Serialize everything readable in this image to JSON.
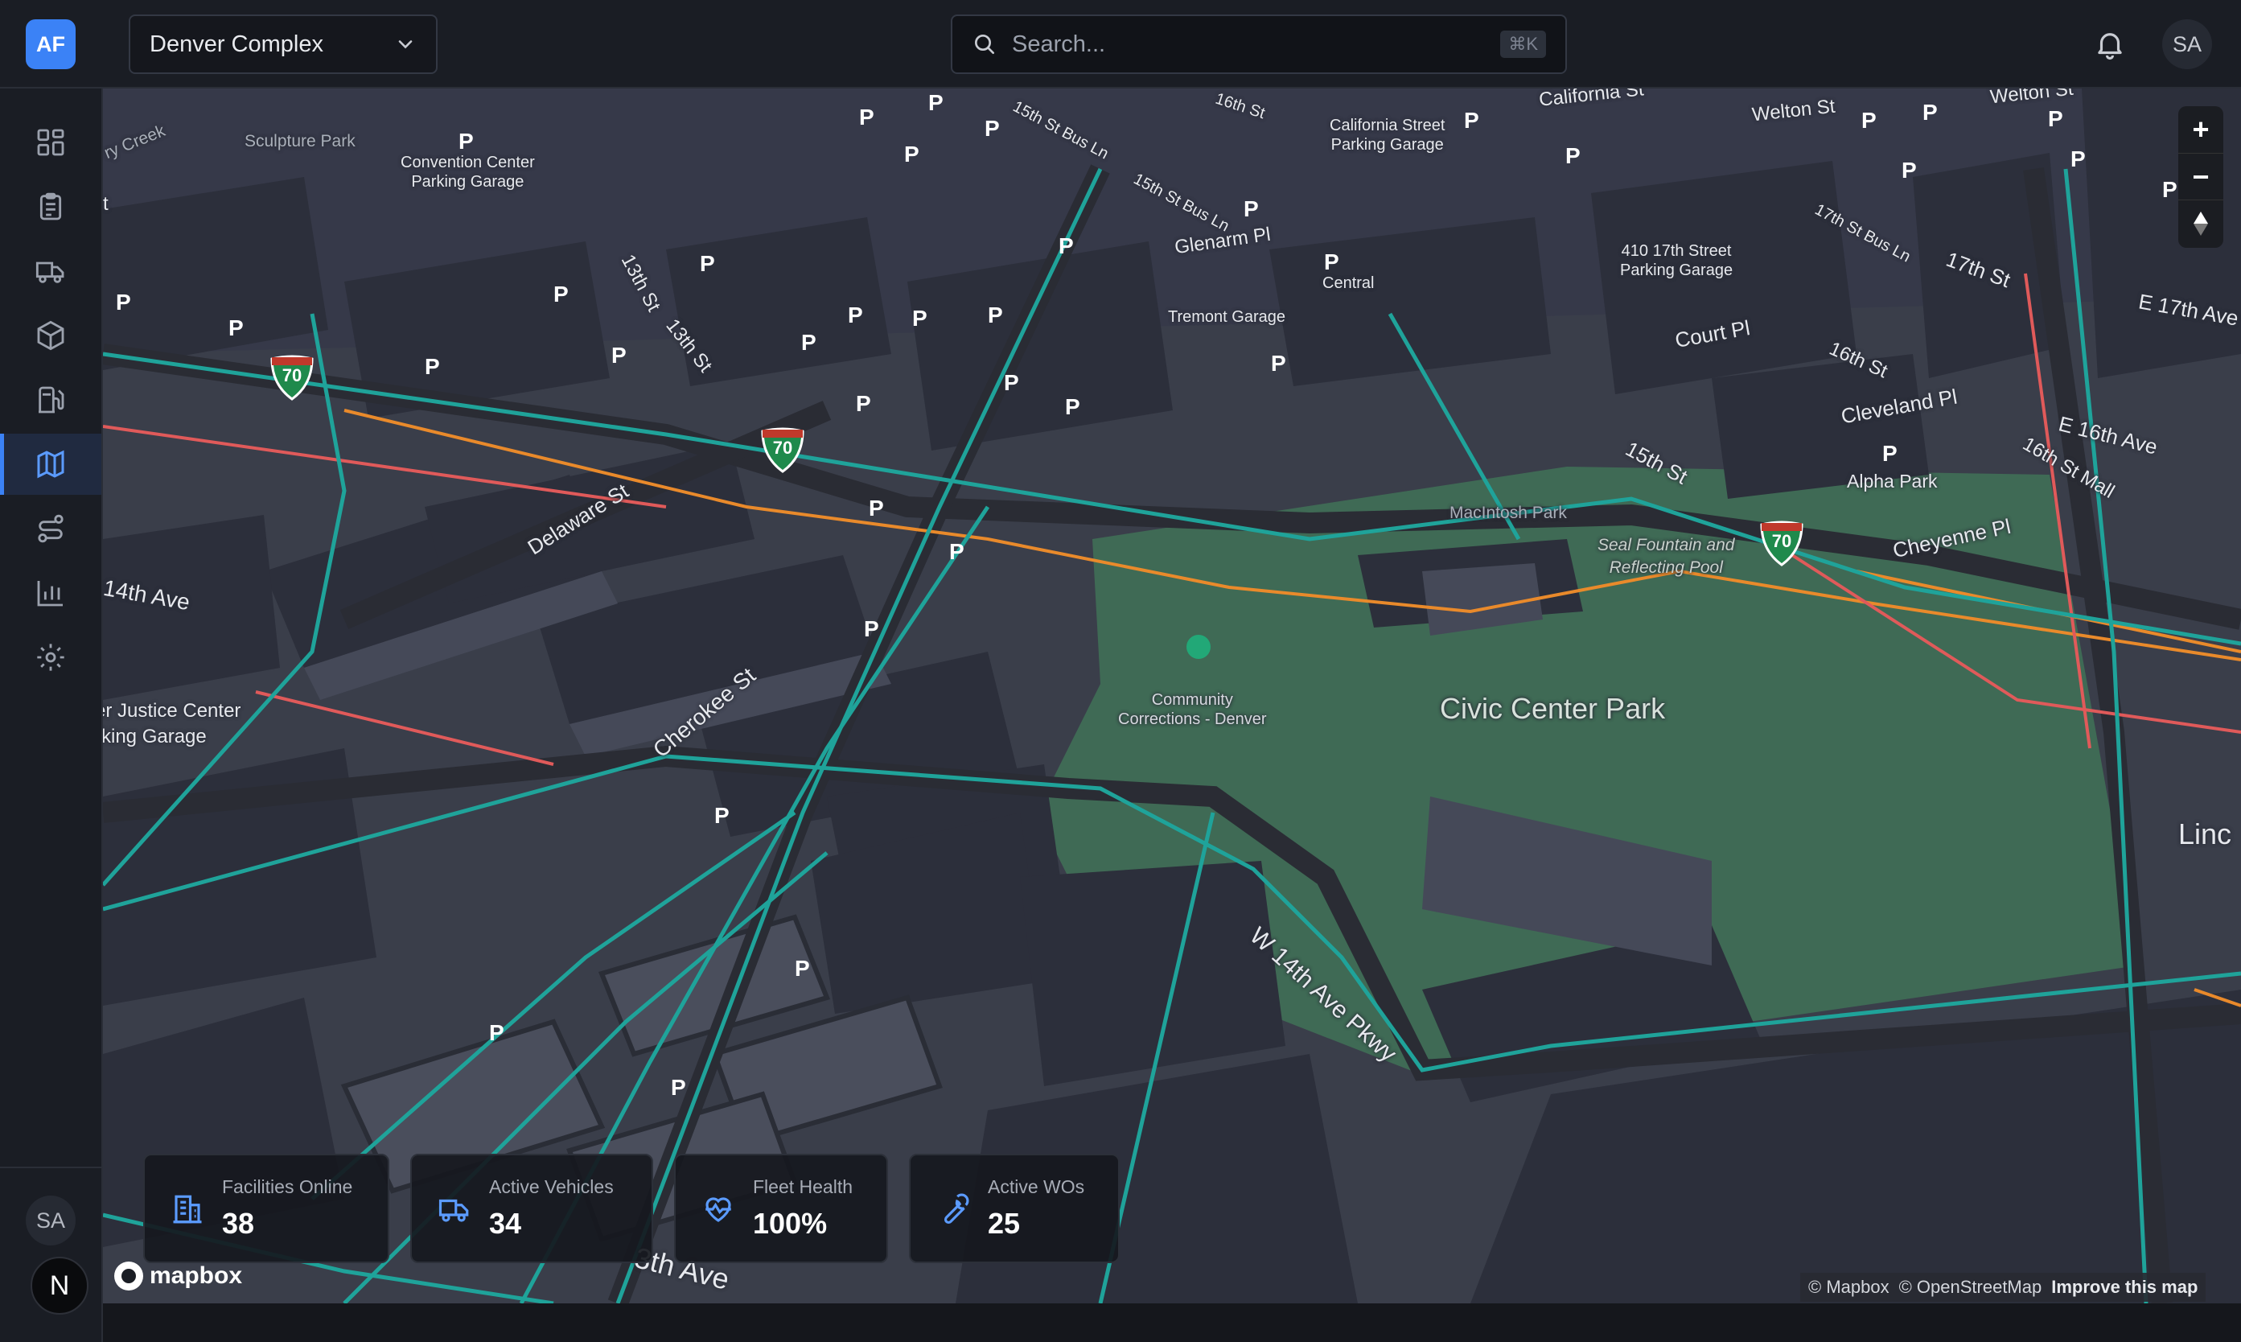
{
  "brand": {
    "initials": "AF"
  },
  "site_selector": {
    "value": "Denver Complex"
  },
  "search": {
    "placeholder": "Search...",
    "shortcut": "⌘K"
  },
  "user": {
    "initials": "SA"
  },
  "sidebar": {
    "items": [
      {
        "icon": "dashboard-icon"
      },
      {
        "icon": "clipboard-icon"
      },
      {
        "icon": "truck-icon"
      },
      {
        "icon": "package-icon"
      },
      {
        "icon": "fuel-pump-icon"
      },
      {
        "icon": "map-icon",
        "active": true
      },
      {
        "icon": "route-icon"
      },
      {
        "icon": "bar-chart-icon"
      },
      {
        "icon": "gear-icon"
      }
    ],
    "avatar": "SA",
    "badge": "N"
  },
  "map": {
    "park_name": "Civic Center Park",
    "street_labels": {
      "sculpture_park": "Sculpture Park",
      "cherry_creek": "ry Creek",
      "convention_center": "Convention Center\nParking Garage",
      "fifteenth_bus": "15th St Bus Ln",
      "sixteenth": "16th St",
      "california_garage": "California Street\nParking Garage",
      "california": "California St",
      "welton": "Welton St",
      "welton2": "Welton St",
      "fifteenth_bus2": "15th St Bus Ln",
      "glenarm": "Glenarm Pl",
      "tremont": "Tremont Garage",
      "central": "Central",
      "garage_410": "410 17th Street\nParking Garage",
      "seventeenth_bus": "17th St Bus Ln",
      "seventeenth": "17th St",
      "e17": "E 17th Ave",
      "court": "Court Pl",
      "sixteenth2": "16th St",
      "cleveland": "Cleveland Pl",
      "e16": "E 16th Ave",
      "mall16": "16th St Mall",
      "alpha": "Alpha Park",
      "fifteenth": "15th St",
      "macintosh": "MacIntosh Park",
      "seal": "Seal Fountain and\nReflecting Pool",
      "cheyenne": "Cheyenne Pl",
      "thirteenth": "13th St",
      "thirteenth2": "13th St",
      "delaware": "Delaware St",
      "fourteenth": "14th Ave",
      "justice": "er Justice Center\nrking Garage",
      "cherokee": "Cherokee St",
      "community": "Community\nCorrections - Denver",
      "w14": "W 14th Ave Pkwy",
      "lincoln": "Linc",
      "thirteenth_ave": "3th Ave",
      "t_left": "t"
    },
    "parking_marker": "P",
    "highway_route": "70",
    "zoom_in": "+",
    "zoom_out": "−",
    "attribution": [
      "© Mapbox",
      "© OpenStreetMap",
      "Improve this map"
    ],
    "logo": "mapbox"
  },
  "stats": [
    {
      "label": "Facilities Online",
      "value": "38",
      "icon": "building-icon"
    },
    {
      "label": "Active Vehicles",
      "value": "34",
      "icon": "truck-icon"
    },
    {
      "label": "Fleet Health",
      "value": "100%",
      "icon": "heart-pulse-icon"
    },
    {
      "label": "Active WOs",
      "value": "25",
      "icon": "wrench-icon"
    }
  ],
  "colors": {
    "accent": "#3b82f6",
    "park": "#3f6a55",
    "transit": "#1fa39a",
    "highway": "#e98a2b",
    "arterial": "#e05a5a",
    "highway_shield": "#1f8a4c"
  }
}
